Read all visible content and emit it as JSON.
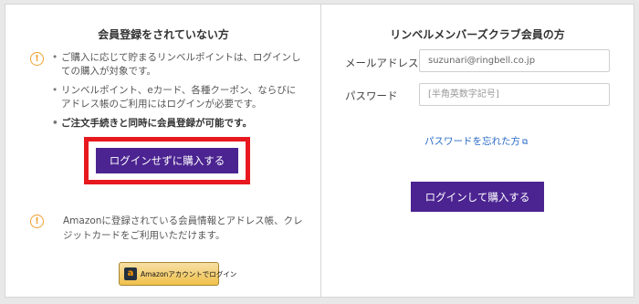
{
  "guest": {
    "title": "会員登録をされていない方",
    "notes": [
      "ご購入に応じて貯まるリンベルポイントは、ログインしての購入が対象です。",
      "リンベルポイント、eカード、各種クーポン、ならびにアドレス帳のご利用にはログインが必要です。",
      "ご注文手続きと同時に会員登録が可能です。"
    ],
    "button_label": "ログインせずに購入する",
    "amazon_text": "Amazonに登録されている会員情報とアドレス帳、クレジットカードをご利用いただけます。",
    "amazon_button_label": "Amazonアカウントでログイン",
    "warning_glyph": "!"
  },
  "member": {
    "title": "リンベルメンバーズクラブ会員の方",
    "email_label": "メールアドレス",
    "email_value": "suzunari@ringbell.co.jp",
    "password_label": "パスワード",
    "password_placeholder": "[半角英数字記号]",
    "forgot_label": "パスワードを忘れた方",
    "forgot_icon": "⧉",
    "login_button_label": "ログインして購入する"
  },
  "colors": {
    "accent_purple": "#4b2491",
    "highlight_red": "#e8181f",
    "warning_orange": "#f0a030",
    "link_blue": "#2a6bc7"
  }
}
